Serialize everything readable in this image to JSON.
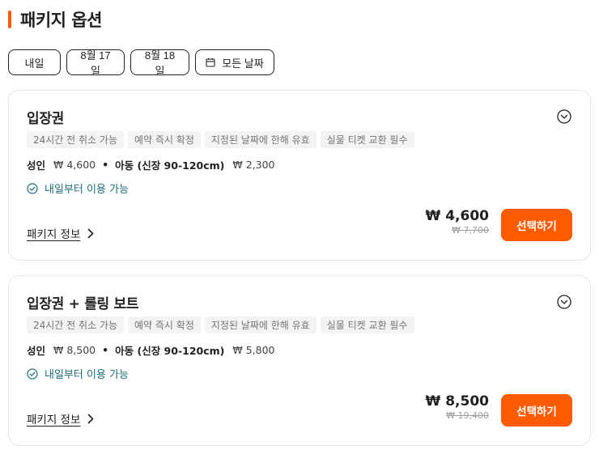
{
  "section": {
    "title": "패키지 옵션"
  },
  "date_chips": [
    {
      "label": "내일"
    },
    {
      "label": "8월 17일"
    },
    {
      "label": "8월 18일"
    },
    {
      "label": "모든 날짜",
      "icon": "calendar-icon"
    }
  ],
  "packages": [
    {
      "title": "입장권",
      "tags": [
        "24시간 전 취소 가능",
        "예약 즉시 확정",
        "지정된 날짜에 한해 유효",
        "실물 티켓 교환 필수"
      ],
      "adult_label": "성인",
      "adult_price": "₩ 4,600",
      "child_label": "아동 (신장 90-120cm)",
      "child_price": "₩ 2,300",
      "separator": "•",
      "availability": "내일부터 이용 가능",
      "info_label": "패키지 정보",
      "price": "₩ 4,600",
      "original_price": "₩ 7,700",
      "select_label": "선택하기"
    },
    {
      "title": "입장권 + 롤링 보트",
      "tags": [
        "24시간 전 취소 가능",
        "예약 즉시 확정",
        "지정된 날짜에 한해 유효",
        "실물 티켓 교환 필수"
      ],
      "adult_label": "성인",
      "adult_price": "₩ 8,500",
      "child_label": "아동 (신장 90-120cm)",
      "child_price": "₩ 5,800",
      "separator": "•",
      "availability": "내일부터 이용 가능",
      "info_label": "패키지 정보",
      "price": "₩ 8,500",
      "original_price": "₩ 19,400",
      "select_label": "선택하기"
    }
  ],
  "colors": {
    "accent": "#ff5b00",
    "availability": "#1a6e7a",
    "tag_bg": "#f3f3f3"
  }
}
